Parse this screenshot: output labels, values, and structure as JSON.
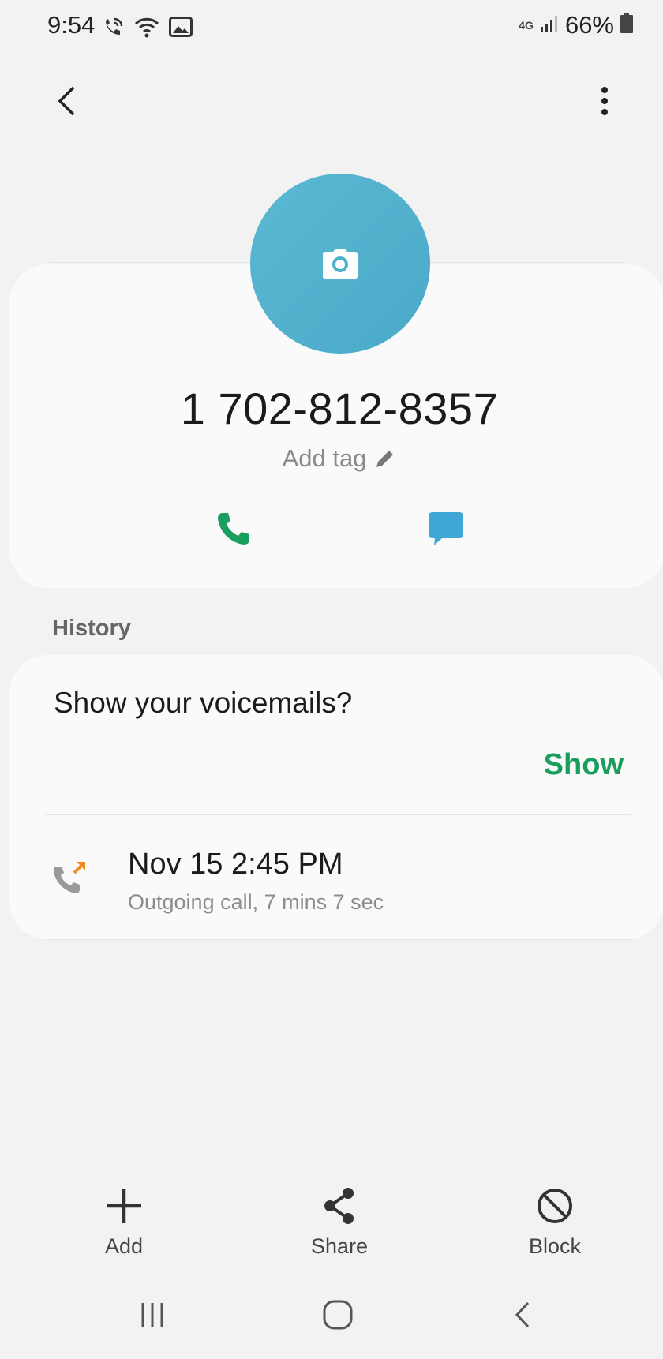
{
  "status_bar": {
    "time": "9:54",
    "network": "4G",
    "battery": "66%"
  },
  "contact": {
    "phone_number": "1 702-812-8357",
    "add_tag": "Add tag"
  },
  "history": {
    "label": "History",
    "voicemail_prompt": "Show your voicemails?",
    "show_label": "Show",
    "entries": [
      {
        "date": "Nov 15 2:45 PM",
        "detail": "Outgoing call, 7 mins 7 sec"
      }
    ]
  },
  "actions": {
    "add": "Add",
    "share": "Share",
    "block": "Block"
  },
  "colors": {
    "avatar": "#4fb0cc",
    "call": "#1a9e5e",
    "message": "#3fa7d6",
    "accent": "#1a9e5e",
    "outgoing_arrow": "#f08a1c"
  }
}
